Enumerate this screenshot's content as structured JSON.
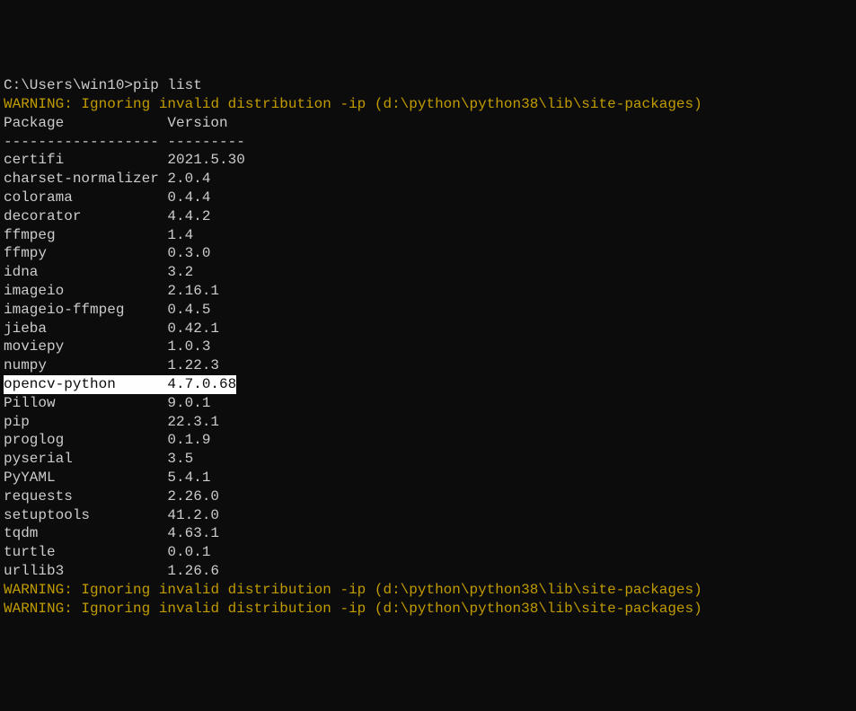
{
  "prompt": "C:\\Users\\win10>pip list",
  "warning_top": "WARNING: Ignoring invalid distribution -ip (d:\\python\\python38\\lib\\site-packages)",
  "header": {
    "package": "Package",
    "version": "Version"
  },
  "divider": {
    "package": "------------------",
    "version": "---------"
  },
  "packages": [
    {
      "name": "certifi",
      "version": "2021.5.30",
      "highlighted": false
    },
    {
      "name": "charset-normalizer",
      "version": "2.0.4",
      "highlighted": false
    },
    {
      "name": "colorama",
      "version": "0.4.4",
      "highlighted": false
    },
    {
      "name": "decorator",
      "version": "4.4.2",
      "highlighted": false
    },
    {
      "name": "ffmpeg",
      "version": "1.4",
      "highlighted": false
    },
    {
      "name": "ffmpy",
      "version": "0.3.0",
      "highlighted": false
    },
    {
      "name": "idna",
      "version": "3.2",
      "highlighted": false
    },
    {
      "name": "imageio",
      "version": "2.16.1",
      "highlighted": false
    },
    {
      "name": "imageio-ffmpeg",
      "version": "0.4.5",
      "highlighted": false
    },
    {
      "name": "jieba",
      "version": "0.42.1",
      "highlighted": false
    },
    {
      "name": "moviepy",
      "version": "1.0.3",
      "highlighted": false
    },
    {
      "name": "numpy",
      "version": "1.22.3",
      "highlighted": false
    },
    {
      "name": "opencv-python",
      "version": "4.7.0.68",
      "highlighted": true
    },
    {
      "name": "Pillow",
      "version": "9.0.1",
      "highlighted": false
    },
    {
      "name": "pip",
      "version": "22.3.1",
      "highlighted": false
    },
    {
      "name": "proglog",
      "version": "0.1.9",
      "highlighted": false
    },
    {
      "name": "pyserial",
      "version": "3.5",
      "highlighted": false
    },
    {
      "name": "PyYAML",
      "version": "5.4.1",
      "highlighted": false
    },
    {
      "name": "requests",
      "version": "2.26.0",
      "highlighted": false
    },
    {
      "name": "setuptools",
      "version": "41.2.0",
      "highlighted": false
    },
    {
      "name": "tqdm",
      "version": "4.63.1",
      "highlighted": false
    },
    {
      "name": "turtle",
      "version": "0.0.1",
      "highlighted": false
    },
    {
      "name": "urllib3",
      "version": "1.26.6",
      "highlighted": false
    }
  ],
  "warning_bottom1": "WARNING: Ignoring invalid distribution -ip (d:\\python\\python38\\lib\\site-packages)",
  "warning_bottom2": "WARNING: Ignoring invalid distribution -ip (d:\\python\\python38\\lib\\site-packages)"
}
